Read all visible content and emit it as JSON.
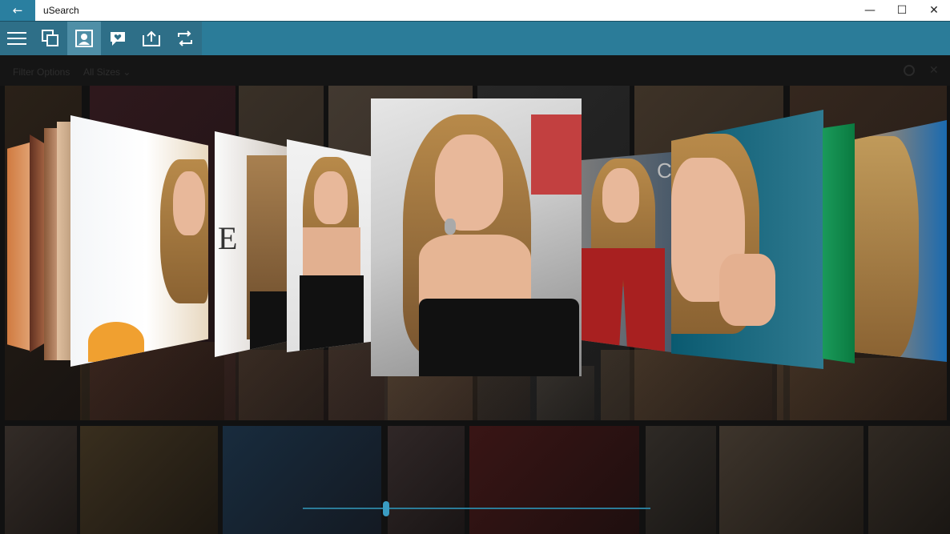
{
  "window": {
    "title": "uSearch",
    "back_icon": "back-arrow-icon",
    "controls": [
      "minimize",
      "maximize",
      "close"
    ]
  },
  "toolbar": {
    "tools": [
      {
        "name": "menu",
        "icon": "hamburger-icon"
      },
      {
        "name": "duplicates",
        "icon": "copy-icon"
      },
      {
        "name": "portrait",
        "icon": "portrait-icon",
        "active": true
      },
      {
        "name": "feedback",
        "icon": "chat-heart-icon"
      },
      {
        "name": "share",
        "icon": "share-up-icon"
      },
      {
        "name": "repeat",
        "icon": "repeat-icon"
      }
    ]
  },
  "filters": {
    "label": "Filter Options",
    "selected": "All Sizes"
  },
  "carousel": {
    "image_count": 11,
    "center_index": 5,
    "slider_fraction": 0.24
  },
  "colors": {
    "accent": "#2b7c99",
    "titlebar": "#ffffff",
    "backdrop": "#111111"
  }
}
